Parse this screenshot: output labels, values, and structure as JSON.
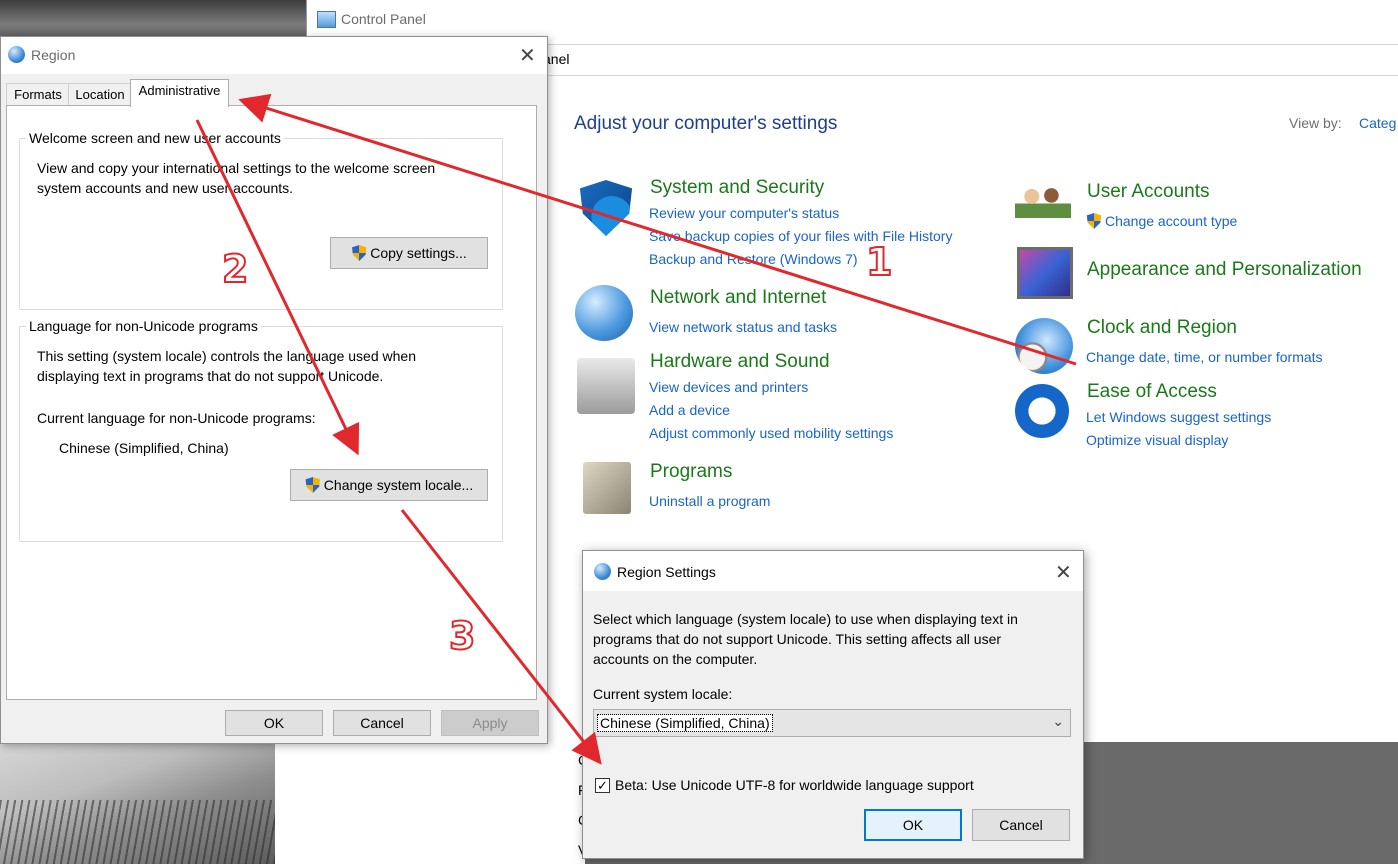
{
  "control_panel": {
    "title": "Control Panel",
    "address_partial": "anel",
    "heading": "Adjust your computer's settings",
    "view_by_label": "View by:",
    "view_by_value": "Categ",
    "categories": [
      {
        "title": "System and Security",
        "icon": "shield-icon",
        "links": [
          "Review your computer's status",
          "Save backup copies of your files with File History",
          "Backup and Restore (Windows 7)"
        ]
      },
      {
        "title": "Network and Internet",
        "icon": "network-globe-icon",
        "links": [
          "View network status and tasks"
        ]
      },
      {
        "title": "Hardware and Sound",
        "icon": "printer-icon",
        "links": [
          "View devices and printers",
          "Add a device",
          "Adjust commonly used mobility settings"
        ]
      },
      {
        "title": "Programs",
        "icon": "programs-box-icon",
        "links": [
          "Uninstall a program"
        ]
      },
      {
        "title": "User Accounts",
        "icon": "users-icon",
        "links": [
          "Change account type"
        ]
      },
      {
        "title": "Appearance and Personalization",
        "icon": "monitor-icon",
        "links": []
      },
      {
        "title": "Clock and Region",
        "icon": "clock-globe-icon",
        "links": [
          "Change date, time, or number formats"
        ]
      },
      {
        "title": "Ease of Access",
        "icon": "ease-of-access-icon",
        "links": [
          "Let Windows suggest settings",
          "Optimize visual display"
        ]
      }
    ],
    "partial_letters": [
      "C",
      "F",
      "C",
      "V"
    ]
  },
  "region_dialog": {
    "title": "Region",
    "tabs": [
      "Formats",
      "Location",
      "Administrative"
    ],
    "active_tab": "Administrative",
    "welcome_group": {
      "label": "Welcome screen and new user accounts",
      "text_line1": "View and copy your international settings to the welcome screen",
      "text_line2": "system accounts and new user accounts.",
      "button": "Copy settings..."
    },
    "unicode_group": {
      "label": "Language for non-Unicode programs",
      "text_line1": "This setting (system locale) controls the language used when",
      "text_line2": "displaying text in programs that do not support Unicode.",
      "current_label": "Current language for non-Unicode programs:",
      "current_value": "Chinese (Simplified, China)",
      "button": "Change system locale..."
    },
    "buttons": {
      "ok": "OK",
      "cancel": "Cancel",
      "apply": "Apply"
    }
  },
  "region_settings_dialog": {
    "title": "Region Settings",
    "description_line1": "Select which language (system locale) to use when displaying text in",
    "description_line2": "programs that do not support Unicode. This setting affects all user",
    "description_line3": "accounts on the computer.",
    "current_locale_label": "Current system locale:",
    "current_locale_value": "Chinese (Simplified, China)",
    "beta_checkbox_label": "Beta: Use Unicode UTF-8 for worldwide language support",
    "beta_checked": true,
    "buttons": {
      "ok": "OK",
      "cancel": "Cancel"
    }
  },
  "annotations": {
    "numbers": [
      "1",
      "2",
      "3"
    ],
    "arrow_color": "#e0282d"
  }
}
